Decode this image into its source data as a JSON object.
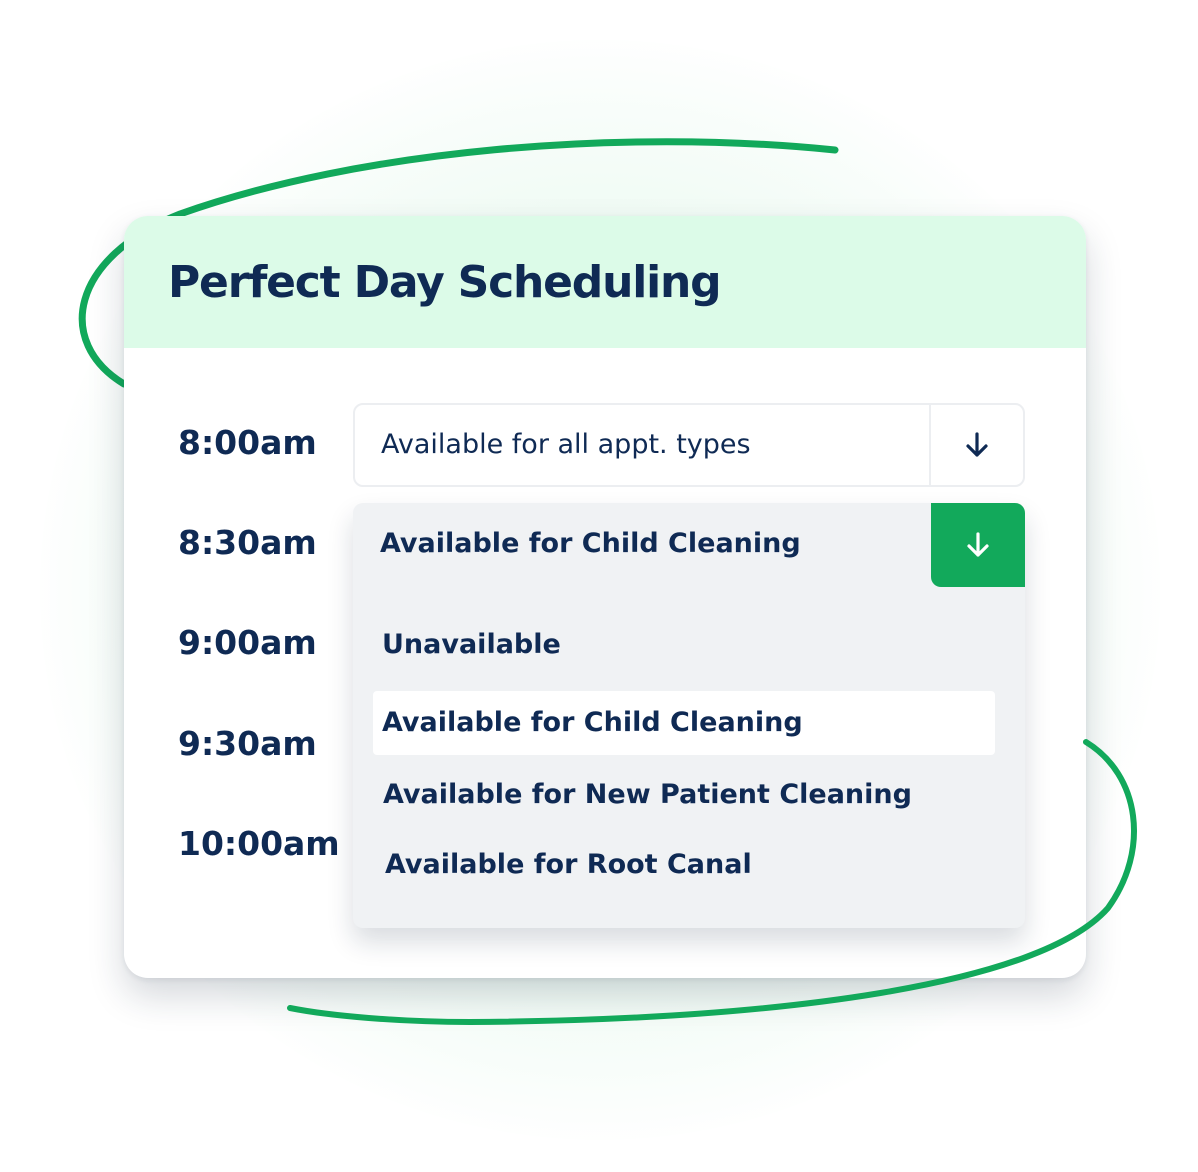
{
  "card": {
    "title": "Perfect Day Scheduling"
  },
  "times": [
    "8:00am",
    "8:30am",
    "9:00am",
    "9:30am",
    "10:00am"
  ],
  "slot_8_00": {
    "select_value": "Available for all appt. types",
    "arrow_icon": "arrow-down-icon"
  },
  "slot_8_30": {
    "selected_value": "Available for Child Cleaning",
    "arrow_icon": "arrow-down-icon",
    "options": [
      "Unavailable",
      "Available for Child Cleaning",
      "Available for New Patient Cleaning",
      "Available for Root Canal"
    ],
    "highlighted_option": "Available for Child Cleaning"
  },
  "colors": {
    "header_bg": "#dcfbe8",
    "text_primary": "#0f2a54",
    "accent_green": "#12a95b",
    "dropdown_bg": "#f0f2f4"
  }
}
